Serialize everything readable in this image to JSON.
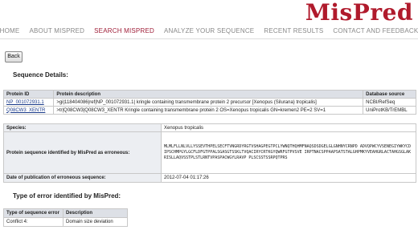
{
  "brand": {
    "logo": "MisPred",
    "accent": "#b01a2c"
  },
  "nav": {
    "items": [
      {
        "label": "HOME",
        "active": false
      },
      {
        "label": "ABOUT MISPRED",
        "active": false
      },
      {
        "label": "SEARCH MISPRED",
        "active": true
      },
      {
        "label": "ANALYZE YOUR SEQUENCE",
        "active": false
      },
      {
        "label": "RECENT RESULTS",
        "active": false
      },
      {
        "label": "CONTACT AND FEEDBACK",
        "active": false
      }
    ]
  },
  "back_label": "Back",
  "sequence_details": {
    "heading": "Sequence Details:",
    "columns": [
      "Protein ID",
      "Protein description",
      "Database source"
    ],
    "rows": [
      {
        "id": "NP_001072931.1",
        "desc": ">gi|118404086|ref|NP_001072931.1| kringle containing transmembrane protein 2 precursor [Xenopus (Silurana) tropicalis]",
        "source": "NCBI/RefSeq"
      },
      {
        "id": "Q08CW3_XENTR",
        "desc": ">tr|Q08CW3|Q08CW3_XENTR Kringle containing transmembrane protein 2 OS=Xenopus tropicalis GN=kremen2 PE=2 SV=1",
        "source": "UniProtKB/TrEMBL"
      }
    ]
  },
  "species_table": {
    "species_label": "Species:",
    "species_value": "Xenopus tropicalis",
    "seq_label": "Protein sequence identified by MisPred as erroneous:",
    "seq_value": "MLMLFLLNLVLLYSSEVTHPELSECFTVNGRDYRGTVSHAGPEGTPCLYWNQTHQHMFNAQSDSDGELGLGNHNYCRNPD ADVQPWCYVSENEGIYWKYCDIPSCHMPGYLGCFLDFGTPPALSGASGTSSKLTVQACIRYCRTKGYQWRFGTPVSVE IRPTNACSPPAAPSATSTALGHPMKYVEAHGRLACTAHGSGLAKRISLLAQVSSTPLSTLRNTVPASPACWGYLRAVP PLSCSSTSSRPQTPRS",
    "date_label": "Date of publication of erroneous sequence:",
    "date_value": "2012-07-04 01:17:26"
  },
  "error_types": {
    "heading": "Type of error identified by MisPred:",
    "columns": [
      "Type of sequence error",
      "Description"
    ],
    "rows": [
      {
        "type": "Conflict 4:",
        "desc": "Domain size deviation"
      }
    ]
  }
}
